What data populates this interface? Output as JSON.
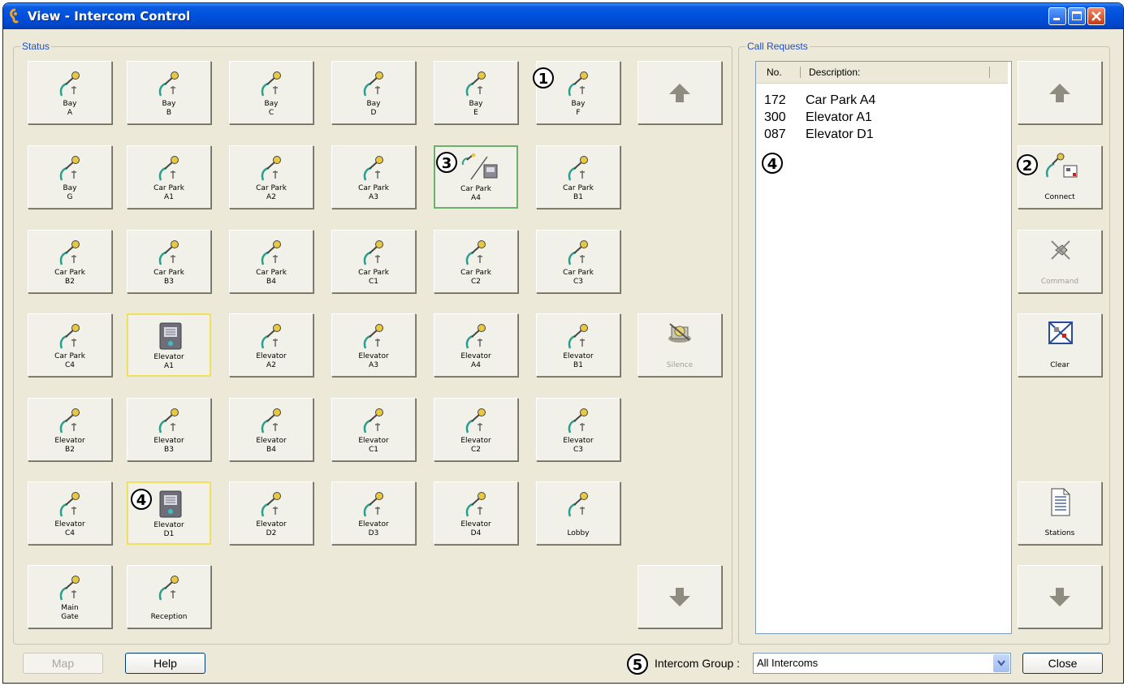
{
  "window": {
    "title": "View - Intercom Control"
  },
  "status": {
    "label": "Status",
    "tiles": [
      {
        "l1": "Bay",
        "l2": "A"
      },
      {
        "l1": "Bay",
        "l2": "B"
      },
      {
        "l1": "Bay",
        "l2": "C"
      },
      {
        "l1": "Bay",
        "l2": "D"
      },
      {
        "l1": "Bay",
        "l2": "E"
      },
      {
        "l1": "Bay",
        "l2": "F"
      },
      {
        "l1": "Bay",
        "l2": "G"
      },
      {
        "l1": "Car Park",
        "l2": "A1"
      },
      {
        "l1": "Car Park",
        "l2": "A2"
      },
      {
        "l1": "Car Park",
        "l2": "A3"
      },
      {
        "l1": "Car Park",
        "l2": "A4",
        "state": "connected"
      },
      {
        "l1": "Car Park",
        "l2": "B1"
      },
      {
        "l1": "Car Park",
        "l2": "B2"
      },
      {
        "l1": "Car Park",
        "l2": "B3"
      },
      {
        "l1": "Car Park",
        "l2": "B4"
      },
      {
        "l1": "Car Park",
        "l2": "C1"
      },
      {
        "l1": "Car Park",
        "l2": "C2"
      },
      {
        "l1": "Car Park",
        "l2": "C3"
      },
      {
        "l1": "Car Park",
        "l2": "C4"
      },
      {
        "l1": "Elevator",
        "l2": "A1",
        "state": "calling"
      },
      {
        "l1": "Elevator",
        "l2": "A2"
      },
      {
        "l1": "Elevator",
        "l2": "A3"
      },
      {
        "l1": "Elevator",
        "l2": "A4"
      },
      {
        "l1": "Elevator",
        "l2": "B1"
      },
      {
        "l1": "Elevator",
        "l2": "B2"
      },
      {
        "l1": "Elevator",
        "l2": "B3"
      },
      {
        "l1": "Elevator",
        "l2": "B4"
      },
      {
        "l1": "Elevator",
        "l2": "C1"
      },
      {
        "l1": "Elevator",
        "l2": "C2"
      },
      {
        "l1": "Elevator",
        "l2": "C3"
      },
      {
        "l1": "Elevator",
        "l2": "C4"
      },
      {
        "l1": "Elevator",
        "l2": "D1",
        "state": "calling"
      },
      {
        "l1": "Elevator",
        "l2": "D2"
      },
      {
        "l1": "Elevator",
        "l2": "D3"
      },
      {
        "l1": "Elevator",
        "l2": "D4"
      },
      {
        "l1": "",
        "l2": "Lobby"
      },
      {
        "l1": "Main",
        "l2": "Gate"
      },
      {
        "l1": "",
        "l2": "Reception"
      }
    ],
    "silence_label": "Silence"
  },
  "call_requests": {
    "label": "Call Requests",
    "columns": [
      "No.",
      "Description:"
    ],
    "rows": [
      {
        "no": "172",
        "desc": "Car Park A4"
      },
      {
        "no": "300",
        "desc": "Elevator A1"
      },
      {
        "no": "087",
        "desc": "Elevator D1"
      }
    ]
  },
  "side_buttons": {
    "connect": "Connect",
    "command": "Command",
    "clear": "Clear",
    "stations": "Stations"
  },
  "markers": {
    "m1": "1",
    "m2": "2",
    "m3": "3",
    "m4": "4",
    "m5": "5"
  },
  "bottom": {
    "map": "Map",
    "help": "Help",
    "group_label": "Intercom Group :",
    "group_value": "All Intercoms",
    "close": "Close"
  },
  "colors": {
    "title_bar": "#0050DD",
    "dialog_bg": "#ECE9D8",
    "calling_border": "#F0E060",
    "connected_border": "#6CB070"
  }
}
